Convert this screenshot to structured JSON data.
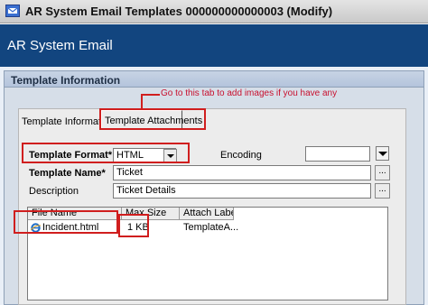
{
  "window": {
    "title": "AR System Email Templates 000000000000003 (Modify)",
    "banner": "AR System Email"
  },
  "section": {
    "title": "Template Information"
  },
  "annotation": {
    "text": "Go to this tab to add images if you have any",
    "color": "#d01e1e"
  },
  "tabs": [
    {
      "label": "Template Information"
    },
    {
      "label": "Template Attachments"
    }
  ],
  "form": {
    "format_label": "Template Format*",
    "format_value": "HTML",
    "encoding_label": "Encoding",
    "encoding_value": "",
    "name_label": "Template Name*",
    "name_value": "Ticket",
    "description_label": "Description",
    "description_value": "Ticket Details",
    "ellipsis": "..."
  },
  "attachments": {
    "columns": [
      "File Name",
      "Max Size",
      "Attach Label"
    ],
    "rows": [
      {
        "file": "Incident.html",
        "size": "1 KB",
        "label": "TemplateA..."
      }
    ],
    "file_icon": "ie-html-icon"
  },
  "colors": {
    "banner": "#12457f",
    "highlight": "#d01e1e"
  }
}
